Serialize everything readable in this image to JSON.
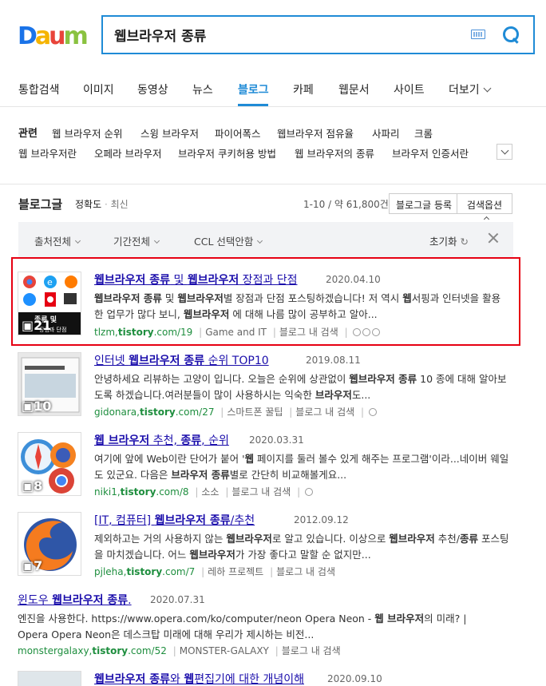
{
  "brand": {
    "logo": [
      "D",
      "a",
      "u",
      "m"
    ],
    "colors": [
      "#1a73e8",
      "#f5b400",
      "#e8443a",
      "#8ac240"
    ]
  },
  "search": {
    "query": "웹브라우저 종류"
  },
  "tabs": [
    "통합검색",
    "이미지",
    "동영상",
    "뉴스",
    "블로그",
    "카페",
    "웹문서",
    "사이트",
    "더보기"
  ],
  "related": {
    "label": "관련",
    "row1": [
      "웹 브라우저 순위",
      "스윙 브라우저",
      "파이어폭스",
      "웹브라우저 점유율",
      "사파리",
      "크롬"
    ],
    "row2": [
      "웹 브라우저란",
      "오페라 브라우저",
      "브라우저 쿠키허용 방법",
      "웹 브라우저의 종류",
      "브라우저 인증서란"
    ]
  },
  "blog": {
    "title": "블로그글",
    "sort_active": "정확도",
    "sort_dot": "·",
    "sort_other": "최신",
    "count": "1-10 / 약 61,800건",
    "register": "블로그글 등록",
    "options": "검색옵션"
  },
  "filters": {
    "source": "출처전체",
    "period": "기간전체",
    "ccl": "CCL 선택안함",
    "reset": "초기화"
  },
  "results": [
    {
      "title_parts": [
        "웹브라우저 종류",
        " 및 ",
        "웹브라우저",
        " 장점과 단점"
      ],
      "date": "2020.04.10",
      "desc_html": "<b>웹브라우저 종류</b> 및 <b>웹브라우저</b>별 장점과 단점 포스팅하겠습니다! 저 역시 <b>웹</b>서핑과 인터넷을 활용한 업무가 많다 보니, <b>웹브라우저</b> 에 대해 나름 많이 공부하고 알아...",
      "domain_plain": "tlzm,",
      "domain_bold": "tistory",
      "domain_rest": ".com/19",
      "category": "Game and IT",
      "inner": "블로그 내 검색",
      "thumb_count": "21"
    },
    {
      "title_parts": [
        "인터넷 ",
        "웹브라우저 종류",
        " 순위 TOP10",
        ""
      ],
      "date": "2019.08.11",
      "desc_html": "안녕하세요 리뷰하는 고양이 입니다. 오늘은 순위에 상관없이 <b>웹브라우저 종류</b> 10 종에 대해 알아보도록 하겠습니다.여러분들이 많이 사용하시는 익숙한 <b>브라우저</b>도...",
      "domain_plain": "gidonara,",
      "domain_bold": "tistory",
      "domain_rest": ".com/27",
      "category": "스마트폰 꿀팁",
      "inner": "블로그 내 검색",
      "thumb_count": "10"
    },
    {
      "title_parts": [
        "웹 브라우저",
        " 추천, ",
        "종류",
        ", 순위"
      ],
      "date": "2020.03.31",
      "desc_html": "여기에 앞에 Web이란 단어가 붙어 '<b>웹</b> 페이지를 둘러 볼수 있게 해주는 프로그램'이라...네이버 웨일도 있군요. 다음은 <b>브라우저 종류</b>별로 간단히 비교해볼게요...",
      "domain_plain": "niki1,",
      "domain_bold": "tistory",
      "domain_rest": ".com/8",
      "category": "소소",
      "inner": "블로그 내 검색",
      "thumb_count": "8"
    },
    {
      "title_parts": [
        "[IT, 컴퓨터] ",
        "웹브라우저 종류",
        "/추천",
        ""
      ],
      "date": "2012.09.12",
      "desc_html": "제외하고는 거의 사용하지 않는 <b>웹브라우저</b>로 알고 있습니다. 이상으로 <b>웹브라우저</b> 추천/<b>종류</b> 포스팅을 마치겠습니다. 어느 <b>웹브라우저</b>가 가장 좋다고 말할 순 없지만...",
      "domain_plain": "pjleha,",
      "domain_bold": "tistory",
      "domain_rest": ".com/7",
      "category": "레하 프로젝트",
      "inner": "블로그 내 검색",
      "thumb_count": "7"
    },
    {
      "title_parts": [
        "윈도우 ",
        "웹브라우저 종류",
        ".",
        ""
      ],
      "date": "2020.07.31",
      "desc_html": "엔진을 사용한다. https://www.opera.com/ko/computer/neon Opera Neon - <b>웹 브라우저</b>의 미래? | Opera Opera Neon은 데스크탑 미래에 대해 우리가 제시하는 비전...",
      "domain_plain": "monstergalaxy,",
      "domain_bold": "tistory",
      "domain_rest": ".com/52",
      "category": "MONSTER-GALAXY",
      "inner": "블로그 내 검색",
      "thumb_count": ""
    },
    {
      "title_parts": [
        "웹브라우저 종류",
        "와 ",
        "웹",
        "편집기에 대한 개념이해"
      ],
      "date": "2020.09.10"
    }
  ]
}
